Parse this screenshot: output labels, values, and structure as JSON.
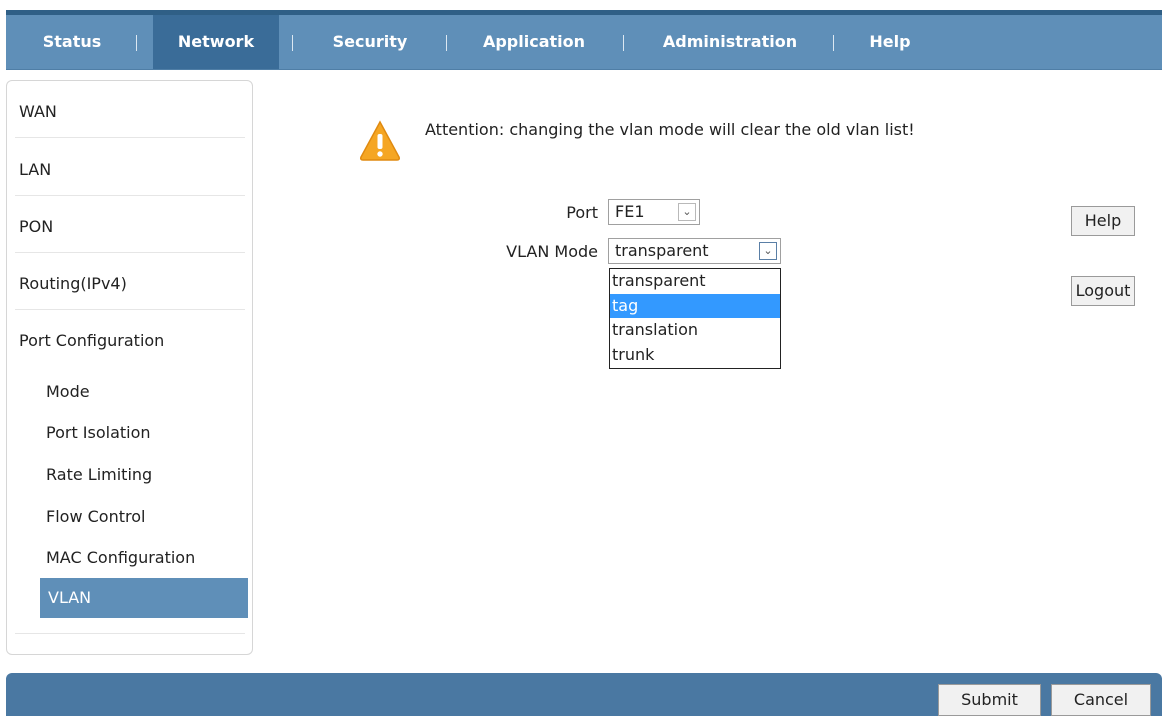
{
  "nav": {
    "tabs": [
      {
        "label": "Status"
      },
      {
        "label": "Network"
      },
      {
        "label": "Security"
      },
      {
        "label": "Application"
      },
      {
        "label": "Administration"
      },
      {
        "label": "Help"
      }
    ],
    "separator": "|",
    "active": "Network"
  },
  "sidebar": {
    "items": [
      {
        "label": "WAN"
      },
      {
        "label": "LAN"
      },
      {
        "label": "PON"
      },
      {
        "label": "Routing(IPv4)"
      },
      {
        "label": "Port Configuration"
      }
    ],
    "subitems": [
      {
        "label": "Mode"
      },
      {
        "label": "Port Isolation"
      },
      {
        "label": "Rate Limiting"
      },
      {
        "label": "Flow Control"
      },
      {
        "label": "MAC Configuration"
      },
      {
        "label": "VLAN"
      }
    ],
    "active_subitem": "VLAN"
  },
  "main": {
    "attention": "Attention: changing the vlan mode will clear the old vlan list!",
    "port_label": "Port",
    "port_value": "FE1",
    "vlan_mode_label": "VLAN Mode",
    "vlan_mode_value": "transparent",
    "vlan_mode_options": [
      "transparent",
      "tag",
      "translation",
      "trunk"
    ],
    "highlighted_option": "tag"
  },
  "side_buttons": {
    "help": "Help",
    "logout": "Logout"
  },
  "footer": {
    "submit": "Submit",
    "cancel": "Cancel"
  },
  "icons": {
    "warning": "warning-triangle-icon",
    "dropdown_arrow": "chevron-down-icon"
  },
  "colors": {
    "nav_bg": "#5f8fb8",
    "nav_active": "#3a6c98",
    "footer_bg": "#4a78a2",
    "option_highlight": "#3399ff",
    "warning": "#f5a623"
  }
}
